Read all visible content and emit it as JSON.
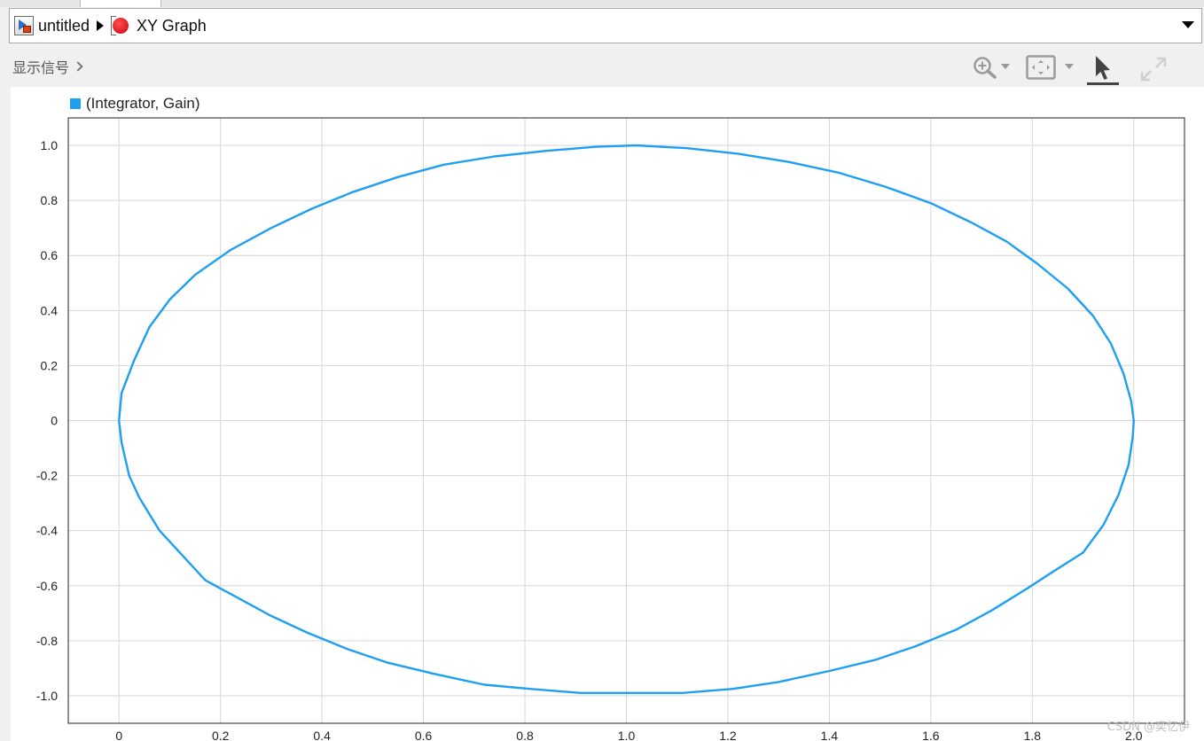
{
  "breadcrumb": {
    "model_name": "untitled",
    "block_name": "XY Graph"
  },
  "toolbar": {
    "signals_label": "显示信号",
    "zoom_icon": "zoom-in-icon",
    "fit_icon": "fit-to-view-icon",
    "pointer_icon": "select-pointer-icon",
    "expand_icon": "expand-icon"
  },
  "legend": {
    "label": "(Integrator, Gain)",
    "color": "#1e9ff2"
  },
  "watermark": "CSDN @奕忆伊",
  "chart_data": {
    "type": "line",
    "title": "",
    "xlabel": "",
    "ylabel": "",
    "xlim": [
      -0.1,
      2.1
    ],
    "ylim": [
      -1.1,
      1.1
    ],
    "grid": true,
    "legend_placement": "top-left",
    "x_ticks": [
      "0",
      "0.2",
      "0.4",
      "0.6",
      "0.8",
      "1.0",
      "1.2",
      "1.4",
      "1.6",
      "1.8",
      "2.0"
    ],
    "y_ticks": [
      "1.0",
      "0.8",
      "0.6",
      "0.4",
      "0.2",
      "0",
      "-0.2",
      "-0.4",
      "-0.6",
      "-0.8",
      "-1.0"
    ],
    "series": [
      {
        "name": "(Integrator, Gain)",
        "color": "#1e9ff2",
        "x": [
          0.0,
          0.005,
          0.03,
          0.06,
          0.1,
          0.15,
          0.22,
          0.3,
          0.38,
          0.46,
          0.55,
          0.64,
          0.74,
          0.84,
          0.94,
          1.02,
          1.12,
          1.22,
          1.32,
          1.42,
          1.51,
          1.6,
          1.68,
          1.75,
          1.81,
          1.87,
          1.92,
          1.955,
          1.98,
          1.995,
          2.0,
          1.998,
          1.99,
          1.97,
          1.94,
          1.9,
          1.84,
          1.79,
          1.72,
          1.65,
          1.57,
          1.49,
          1.4,
          1.3,
          1.21,
          1.11,
          1.0,
          0.91,
          0.81,
          0.72,
          0.62,
          0.53,
          0.45,
          0.37,
          0.3,
          0.22,
          0.17,
          0.11,
          0.08,
          0.04,
          0.02,
          0.005,
          0.0
        ],
        "y": [
          0.0,
          0.1,
          0.22,
          0.34,
          0.44,
          0.53,
          0.62,
          0.7,
          0.77,
          0.83,
          0.885,
          0.93,
          0.96,
          0.98,
          0.995,
          1.0,
          0.99,
          0.97,
          0.94,
          0.9,
          0.85,
          0.79,
          0.72,
          0.65,
          0.57,
          0.48,
          0.38,
          0.28,
          0.17,
          0.07,
          0.0,
          -0.06,
          -0.16,
          -0.27,
          -0.38,
          -0.48,
          -0.55,
          -0.61,
          -0.69,
          -0.76,
          -0.82,
          -0.87,
          -0.91,
          -0.95,
          -0.975,
          -0.99,
          -0.99,
          -0.99,
          -0.975,
          -0.96,
          -0.92,
          -0.88,
          -0.83,
          -0.77,
          -0.71,
          -0.63,
          -0.58,
          -0.46,
          -0.4,
          -0.28,
          -0.2,
          -0.08,
          0.0
        ]
      }
    ]
  }
}
